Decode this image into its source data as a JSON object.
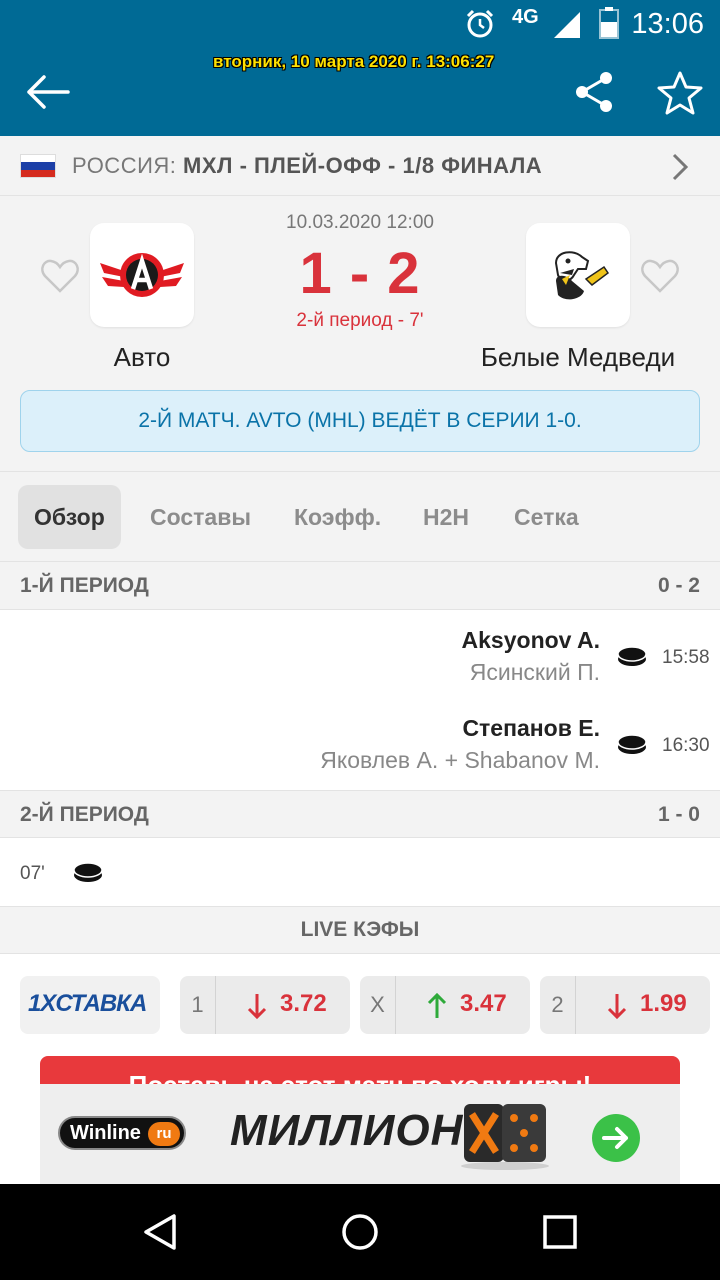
{
  "status_bar": {
    "time": "13:06",
    "network": "4G"
  },
  "header": {
    "timestamp_overlay": "вторник, 10 марта 2020 г. 13:06:27",
    "back_icon": "arrow-left-icon",
    "share_icon": "share-icon",
    "favorite_icon": "star-outline-icon"
  },
  "breadcrumb": {
    "country": "РОССИЯ:",
    "competition": "МХЛ - ПЛЕЙ-ОФФ - 1/8 ФИНАЛА",
    "flag_colors": [
      "#ffffff",
      "#1c3fa7",
      "#d52b1e"
    ]
  },
  "match": {
    "date": "10.03.2020 12:00",
    "score": "1 - 2",
    "status": "2-й период - 7'",
    "home_team": "Авто",
    "away_team": "Белые Медведи",
    "series_info": "2-Й МАТЧ. AVTO (MHL) ВЕДЁТ В СЕРИИ 1-0."
  },
  "tabs": [
    {
      "label": "Обзор",
      "active": true
    },
    {
      "label": "Составы",
      "active": false
    },
    {
      "label": "Коэфф.",
      "active": false
    },
    {
      "label": "H2H",
      "active": false
    },
    {
      "label": "Сетка",
      "active": false
    }
  ],
  "periods": [
    {
      "title": "1-Й ПЕРИОД",
      "score": "0 - 2",
      "events": [
        {
          "scorer": "Aksyonov A.",
          "assist": "Ясинский П.",
          "time": "15:58"
        },
        {
          "scorer": "Степанов Е.",
          "assist": "Яковлев А. + Shabanov M.",
          "time": "16:30"
        }
      ]
    },
    {
      "title": "2-Й ПЕРИОД",
      "score": "1 - 0",
      "events": [
        {
          "time": "07'"
        }
      ]
    }
  ],
  "live_odds": {
    "title": "LIVE КЭФЫ",
    "bookmaker": "1XСТАВКА",
    "odds": [
      {
        "label": "1",
        "value": "3.72",
        "trend": "down"
      },
      {
        "label": "X",
        "value": "3.47",
        "trend": "up"
      },
      {
        "label": "2",
        "value": "1.99",
        "trend": "down"
      }
    ]
  },
  "ad": {
    "headline": "Поставь на этот матч по ходу игры!",
    "brand": "Winline",
    "brand_suffix": "ru",
    "slogan": "МИЛЛИОН"
  },
  "colors": {
    "brand_blue": "#006a95",
    "score_red": "#d9323b",
    "arrow_up": "#2eaa3a",
    "arrow_down": "#d9323b"
  }
}
